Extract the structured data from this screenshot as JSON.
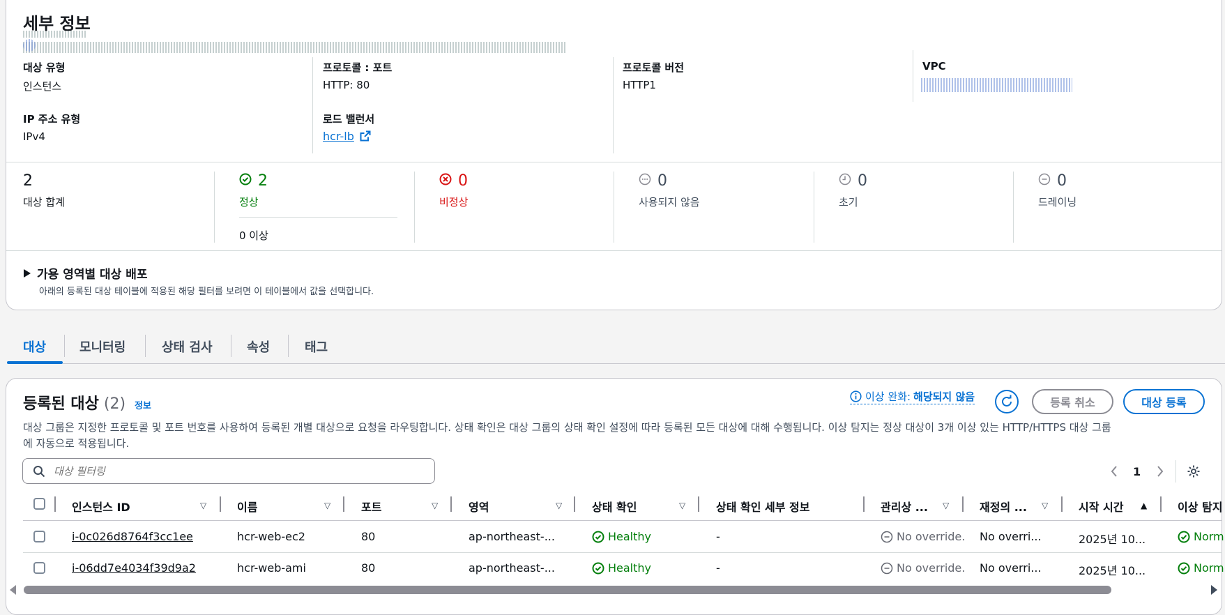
{
  "details": {
    "title": "세부 정보",
    "target_type_label": "대상 유형",
    "target_type_value": "인스턴스",
    "protocol_port_label": "프로토콜 : 포트",
    "protocol_port_value": "HTTP: 80",
    "protocol_version_label": "프로토콜 버전",
    "protocol_version_value": "HTTP1",
    "vpc_label": "VPC",
    "ip_type_label": "IP 주소 유형",
    "ip_type_value": "IPv4",
    "lb_label": "로드 밸런서",
    "lb_value": "hcr-lb"
  },
  "stats": {
    "total_num": "2",
    "total_label": "대상 합계",
    "healthy_num": "2",
    "healthy_label": "정상",
    "anomaly": "0 이상",
    "unhealthy_num": "0",
    "unhealthy_label": "비정상",
    "unused_num": "0",
    "unused_label": "사용되지 않음",
    "initial_num": "0",
    "initial_label": "초기",
    "draining_num": "0",
    "draining_label": "드레이닝"
  },
  "az": {
    "title": "가용 영역별 대상 배포",
    "desc": "아래의 등록된 대상 테이블에 적용된 해당 필터를 보려면 이 테이블에서 값을 선택합니다."
  },
  "tabs": [
    "대상",
    "모니터링",
    "상태 검사",
    "속성",
    "태그"
  ],
  "registered": {
    "title": "등록된 대상",
    "count": "(2)",
    "info": "정보",
    "mitigation_label": "이상 완화:",
    "mitigation_value": "해당되지 않음",
    "deregister": "등록 취소",
    "register": "대상 등록",
    "desc_line1": "대상 그룹은 지정한 프로토콜 및 포트 번호를 사용하여 등록된 개별 대상으로 요청을 라우팅합니다. 상태 확인은 대상 그룹의 상태 확인 설정에 따라 등록된 모든 대상에 대해 수행됩니다. 이상 탐지는 정상 대상이 3개 이상 있는 HTTP/HTTPS 대상 그룹",
    "desc_line2": "에 자동으로 적용됩니다.",
    "filter_placeholder": "대상 필터링",
    "page": "1"
  },
  "table": {
    "headers": [
      "인스턴스 ID",
      "이름",
      "포트",
      "영역",
      "상태 확인",
      "상태 확인 세부 정보",
      "관리상 ...",
      "재정의 ...",
      "시작 시간",
      "이상 탐지"
    ],
    "rows": [
      {
        "id": "i-0c026d8764f3cc1ee",
        "name": "hcr-web-ec2",
        "port": "80",
        "zone": "ap-northeast-...",
        "health": "Healthy",
        "details": "-",
        "admin": "No override.",
        "override": "No overri...",
        "start": "2025년 10...",
        "anomaly": "Norm"
      },
      {
        "id": "i-06dd7e4034f39d9a2",
        "name": "hcr-web-ami",
        "port": "80",
        "zone": "ap-northeast-...",
        "health": "Healthy",
        "details": "-",
        "admin": "No override.",
        "override": "No overri...",
        "start": "2025년 10...",
        "anomaly": "Norm"
      }
    ]
  },
  "colors": {
    "link": "#0972d3",
    "healthy": "#037f0c",
    "unhealthy": "#d91515"
  }
}
